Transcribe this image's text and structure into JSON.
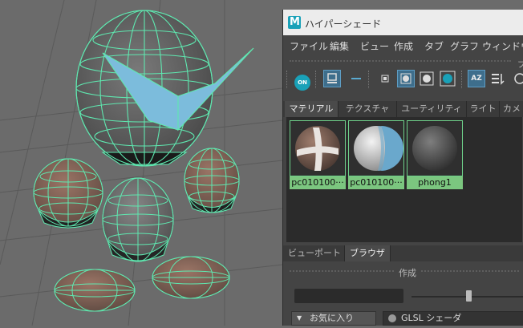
{
  "window": {
    "title": "ハイパーシェード",
    "app_icon_letter": "M",
    "app_icon_color": "#19a1b8"
  },
  "menu": [
    "ファイル",
    "編集",
    "ビュー",
    "作成",
    "タブ",
    "グラフ",
    "ウィンドウ"
  ],
  "panel_label": "ブ",
  "toolbar": {
    "on_label": "ON",
    "sort_label": "AZ",
    "icons": [
      "on-toggle-icon",
      "browser-view-icon",
      "dash-icon",
      "small-swatch-icon",
      "medium-swatch-icon",
      "large-swatch-icon",
      "xlarge-swatch-icon",
      "sort-az-icon",
      "sort-type-icon",
      "sort-time-icon"
    ]
  },
  "tabs": [
    {
      "label": "マテリアル",
      "active": true
    },
    {
      "label": "テクスチャ",
      "active": false
    },
    {
      "label": "ユーティリティ",
      "active": false
    },
    {
      "label": "ライト",
      "active": false
    },
    {
      "label": "カメ",
      "active": false
    }
  ],
  "swatches": [
    {
      "label": "pc010100···",
      "kind": "brown-white-cross"
    },
    {
      "label": "pc010100···",
      "kind": "white-blue"
    },
    {
      "label": "phong1",
      "kind": "gray"
    }
  ],
  "bottom_tabs": [
    {
      "label": "ビューポート",
      "active": false
    },
    {
      "label": "ブラウザ",
      "active": true
    }
  ],
  "create_section": {
    "title": "作成",
    "favorites_label": "お気に入り",
    "shader_label": "GLSL シェーダ"
  },
  "colors": {
    "wireframe": "#5fe8b0",
    "selected_swatch_border": "#6fd38c",
    "swatch_label_bg": "#7bc67f",
    "active_tool_bg": "#3e6e8c"
  }
}
